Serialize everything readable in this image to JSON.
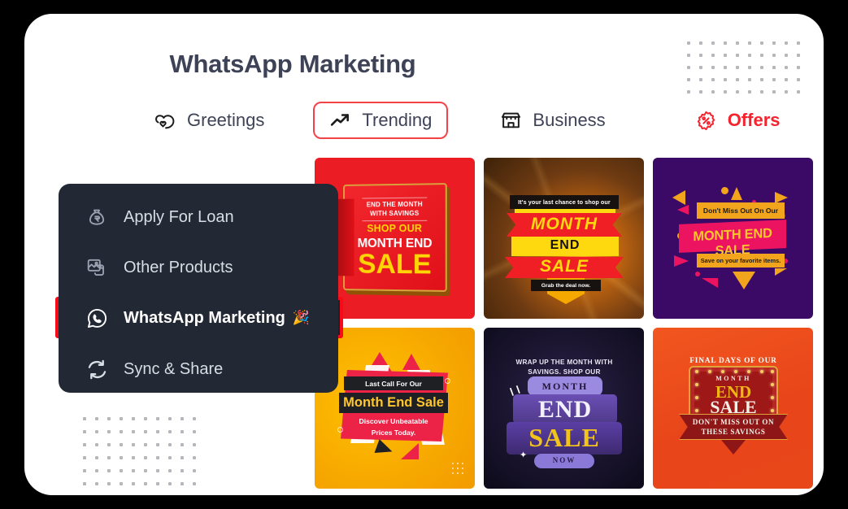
{
  "page": {
    "title": "WhatsApp Marketing",
    "accent_red": "#f4232e",
    "title_color": "#3d4257",
    "panel_bg": "#222834",
    "highlight_border": "#fa0a18"
  },
  "tabs": [
    {
      "label": "Greetings",
      "icon": "heart-chat-icon",
      "selected": false,
      "accent": false
    },
    {
      "label": "Trending",
      "icon": "trending-arrow-icon",
      "selected": true,
      "accent": false
    },
    {
      "label": "Business",
      "icon": "storefront-icon",
      "selected": false,
      "accent": false
    },
    {
      "label": "Offers",
      "icon": "discount-badge-icon",
      "selected": false,
      "accent": true
    }
  ],
  "menu": {
    "items": [
      {
        "label": "Apply For Loan",
        "icon": "money-bag-icon",
        "active": false,
        "emoji": ""
      },
      {
        "label": "Other Products",
        "icon": "documents-icon",
        "active": false,
        "emoji": ""
      },
      {
        "label": "WhatsApp Marketing",
        "icon": "whatsapp-icon",
        "active": true,
        "emoji": "🎉"
      },
      {
        "label": "Sync & Share",
        "icon": "sync-icon",
        "active": false,
        "emoji": ""
      }
    ]
  },
  "gallery": {
    "cards": [
      {
        "id": "card-red-book",
        "background": "#ec1c24",
        "lines": {
          "l1": "END THE MONTH",
          "l2": "WITH SAVINGS",
          "l3": "SHOP OUR",
          "l4": "MONTH END",
          "l5": "SALE"
        }
      },
      {
        "id": "card-brown-ribbon",
        "background": "#6d3a12",
        "lines": {
          "top": "It's your last chance to shop our",
          "month": "MONTH",
          "end": "END",
          "sale": "SALE",
          "bottom": "Grab the deal now."
        }
      },
      {
        "id": "card-purple-burst",
        "background": "#3b0a66",
        "lines": {
          "top": "Don't Miss Out On Our",
          "main": "MONTH END SALE",
          "bottom": "Save on your favorite items."
        }
      },
      {
        "id": "card-yellow-lastcall",
        "background": "#f7a800",
        "lines": {
          "top": "Last Call For Our",
          "main": "Month End Sale",
          "sub1": "Discover Unbeatable",
          "sub2": "Prices Today."
        }
      },
      {
        "id": "card-navy-3d",
        "background": "#1d1733",
        "lines": {
          "hdr1": "WRAP UP THE MONTH WITH",
          "hdr2": "SAVINGS. SHOP OUR",
          "month": "MONTH",
          "end": "END",
          "sale": "SALE",
          "now": "NOW"
        }
      },
      {
        "id": "card-orange-marquee",
        "background": "#e8461a",
        "lines": {
          "hdr": "FINAL DAYS OF OUR",
          "month": "MONTH",
          "end": "END",
          "sale": "SALE",
          "r1": "DON'T MISS OUT ON",
          "r2": "THESE SAVINGS"
        }
      }
    ]
  },
  "decor": {
    "dots_top_right": {
      "cols": 10,
      "rows": 5,
      "color": "#b6b6bd"
    },
    "dots_bottom_left": {
      "cols": 10,
      "rows": 6,
      "color": "#b6b6bd"
    }
  }
}
